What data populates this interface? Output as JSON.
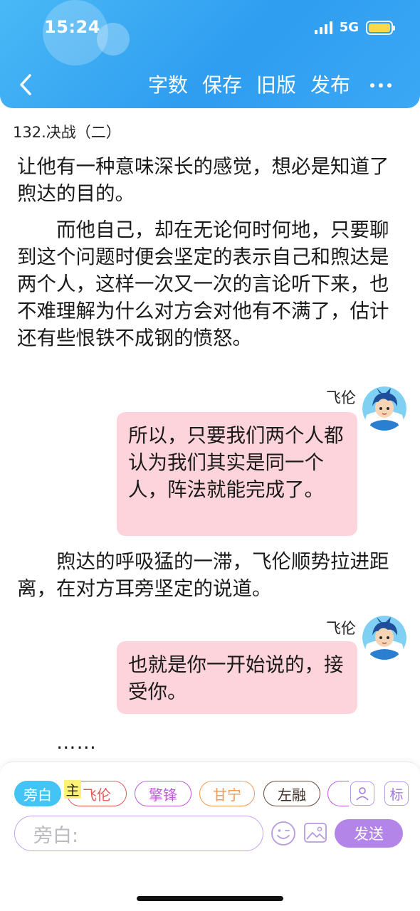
{
  "status_bar": {
    "time": "15:24",
    "network": "5G",
    "battery_color": "#ffd84a"
  },
  "toolbar": {
    "back_icon": "chevron-left-icon",
    "word_count_label": "字数",
    "save_label": "保存",
    "old_version_label": "旧版",
    "publish_label": "发布",
    "more_icon": "more-dots-icon"
  },
  "content": {
    "chapter_title": "132.决战（二）",
    "paragraph_1": "让他有一种意味深长的感觉，想必是知道了煦达的目的。",
    "paragraph_2": "而他自己，却在无论何时何地，只要聊到这个问题时便会坚定的表示自己和煦达是两个人，这样一次又一次的言论听下来，也不难理解为什么对方会对他有不满了，估计还有些恨铁不成钢的愤怒。",
    "dialogue_1": {
      "speaker": "飞伦",
      "text": "所以，只要我们两个人都认为我们其实是同一个人，阵法就能完成了。"
    },
    "paragraph_3": "煦达的呼吸猛的一滞，飞伦顺势拉进距离，在对方耳旁坚定的说道。",
    "dialogue_2": {
      "speaker": "飞伦",
      "text": "也就是你一开始说的，接受你。"
    },
    "paragraph_4": "……"
  },
  "editor": {
    "characters": [
      {
        "label": "旁白",
        "color": "#43c4f5"
      },
      {
        "label": "飞伦",
        "color": "#e05a5a"
      },
      {
        "label": "擎锋",
        "color": "#c05bd8"
      },
      {
        "label": "甘宁",
        "color": "#f29a52"
      },
      {
        "label": "左融",
        "color": "#6a4a3a"
      }
    ],
    "main_tag": "主",
    "person_icon": "person-icon",
    "mark_label": "标",
    "input_placeholder": "旁白:",
    "emoji_icon": "emoji-icon",
    "image_icon": "image-icon",
    "send_label": "发送",
    "accent_color": "#b485e8"
  }
}
